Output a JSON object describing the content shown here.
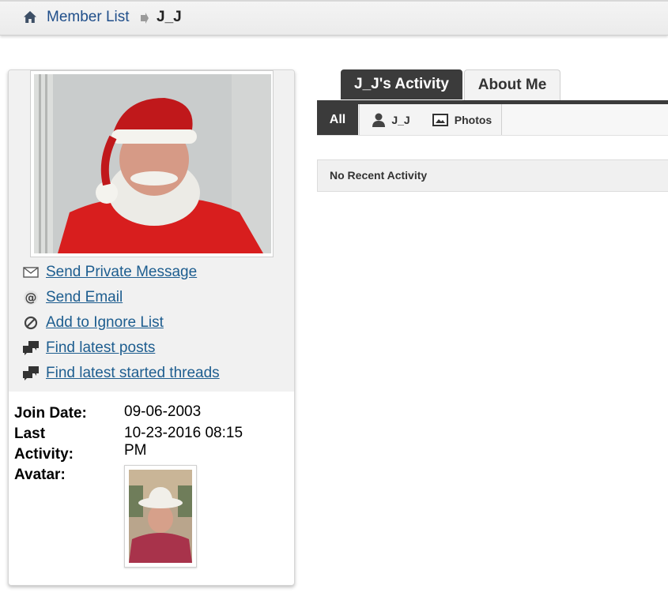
{
  "breadcrumb": {
    "home_icon": "home-icon",
    "member_list": "Member List",
    "separator_icon": "arrow-right-icon",
    "current": "J_J"
  },
  "sidebar": {
    "actions": [
      {
        "icon": "envelope-icon",
        "label": "Send Private Message"
      },
      {
        "icon": "at-sign-icon",
        "label": "Send Email"
      },
      {
        "icon": "block-icon",
        "label": "Add to Ignore List"
      },
      {
        "icon": "chat-bubbles-icon",
        "label": "Find latest posts"
      },
      {
        "icon": "chat-bubbles-icon",
        "label": "Find latest started threads"
      }
    ],
    "info": {
      "join_date_label": "Join Date:",
      "join_date_value": "09-06-2003",
      "last_activity_label_1": "Last",
      "last_activity_label_2": "Activity:",
      "last_activity_value_1": "10-23-2016 08:15",
      "last_activity_value_2": "PM",
      "avatar_label": "Avatar:"
    }
  },
  "tabs": {
    "activity": "J_J's Activity",
    "about": "About Me"
  },
  "subtabs": {
    "all": "All",
    "user": "J_J",
    "photos": "Photos"
  },
  "activity": {
    "empty_text": "No Recent Activity"
  },
  "colors": {
    "link": "#1d5d8f",
    "breadcrumb_link": "#1f4e8a",
    "tab_active": "#3b3b3b"
  }
}
